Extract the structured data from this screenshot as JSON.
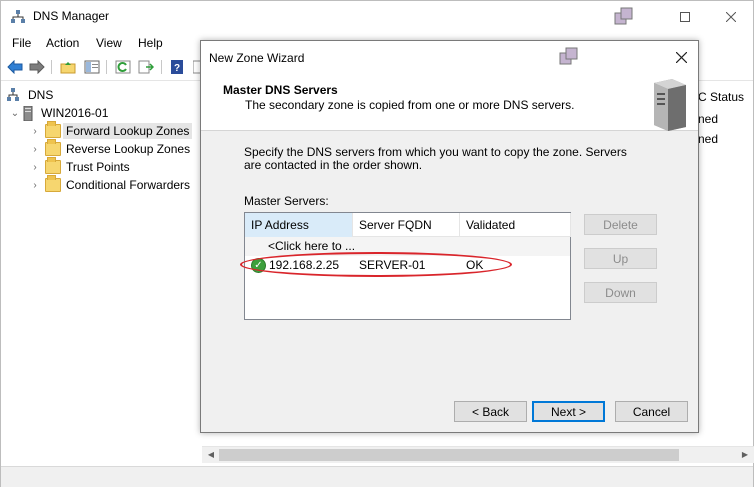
{
  "app": {
    "title": "DNS Manager",
    "menu": [
      "File",
      "Action",
      "View",
      "Help"
    ]
  },
  "tree": {
    "root": "DNS",
    "server": "WIN2016-01",
    "items": [
      "Forward Lookup Zones",
      "Reverse Lookup Zones",
      "Trust Points",
      "Conditional Forwarders"
    ],
    "selected_index": 0
  },
  "right_pane": {
    "column_header_partial": "C Status",
    "cells_partial": [
      "ned",
      "ned"
    ]
  },
  "wizard": {
    "title": "New Zone Wizard",
    "heading": "Master DNS Servers",
    "subheading": "The secondary zone is copied from one or more DNS servers.",
    "instructions": "Specify the DNS servers from which you want to copy the zone.  Servers are contacted in the order shown.",
    "list_label": "Master Servers:",
    "columns": [
      "IP Address",
      "Server FQDN",
      "Validated"
    ],
    "placeholder_row": "<Click here to ...",
    "rows": [
      {
        "ip": "192.168.2.25",
        "fqdn": "SERVER-01",
        "validated": "OK",
        "status_icon": "check-circle-icon"
      }
    ],
    "side_buttons": {
      "delete": "Delete",
      "up": "Up",
      "down": "Down"
    },
    "nav_buttons": {
      "back": "< Back",
      "next": "Next >",
      "cancel": "Cancel"
    },
    "annotation_color": "#d9252b"
  },
  "colors": {
    "accent": "#0078d7",
    "ok_green": "#3ca03c",
    "header_hot": "#d9ebf9"
  }
}
